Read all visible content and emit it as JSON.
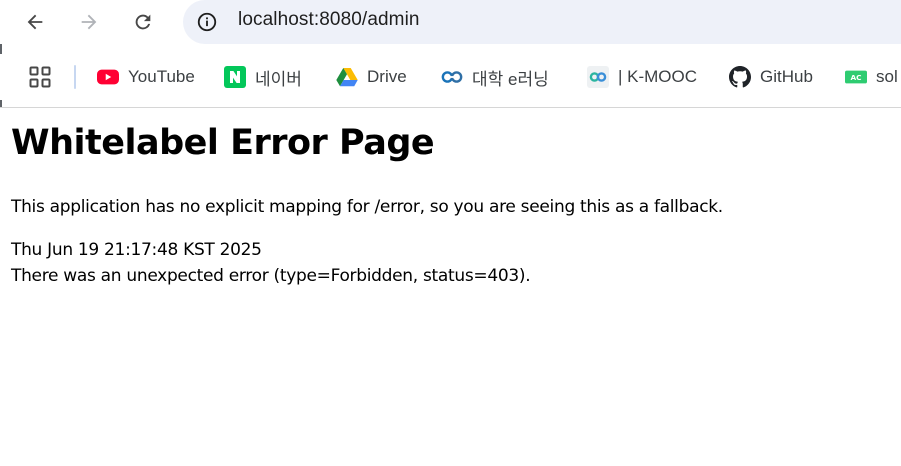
{
  "browser": {
    "nav": {
      "back_icon": "arrow-back-icon",
      "forward_icon": "arrow-forward-icon",
      "reload_icon": "reload-icon"
    },
    "address_bar": {
      "site_info_icon": "info-icon",
      "url": "localhost:8080/admin"
    },
    "bookmarks": {
      "apps_icon": "apps-grid-icon",
      "items": [
        {
          "label": "YouTube",
          "icon": "youtube-icon",
          "color": "#ff0033"
        },
        {
          "label": "네이버",
          "icon": "naver-icon",
          "color": "#03c75a"
        },
        {
          "label": "Drive",
          "icon": "google-drive-icon",
          "color": "#1e8e3e"
        },
        {
          "label": "대학 e러닝",
          "icon": "elearning-icon",
          "color": "#1a73b8"
        },
        {
          "label": "| K-MOOC",
          "icon": "kmooc-icon",
          "color": "#2bb5a0"
        },
        {
          "label": "GitHub",
          "icon": "github-icon",
          "color": "#1f2328"
        },
        {
          "label": "sol",
          "icon": "solvedac-icon",
          "color": "#2ecc71"
        }
      ]
    }
  },
  "page": {
    "title": "Whitelabel Error Page",
    "message": "This application has no explicit mapping for /error, so you are seeing this as a fallback.",
    "timestamp": "Thu Jun 19 21:17:48 KST 2025",
    "error_detail": "There was an unexpected error (type=Forbidden, status=403)."
  }
}
